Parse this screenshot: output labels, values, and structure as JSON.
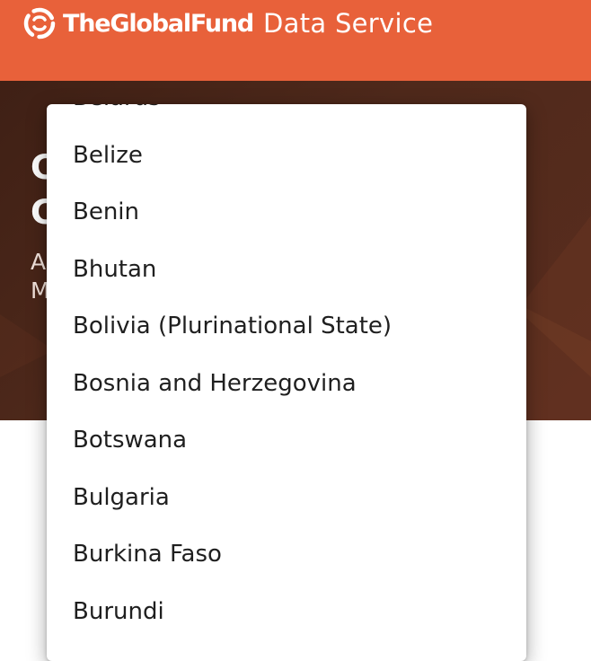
{
  "header": {
    "brand": "TheGlobalFund",
    "suffix": "Data Service",
    "colors": {
      "header_bg": "#e8613a",
      "hero_bg": "#4a261a"
    }
  },
  "hero": {
    "title_lines": [
      "C",
      "C"
    ],
    "subtitle_lines": [
      "A",
      "M"
    ]
  },
  "dropdown": {
    "items": [
      "Belarus",
      "Belize",
      "Benin",
      "Bhutan",
      "Bolivia (Plurinational State)",
      "Bosnia and Herzegovina",
      "Botswana",
      "Bulgaria",
      "Burkina Faso",
      "Burundi"
    ]
  }
}
